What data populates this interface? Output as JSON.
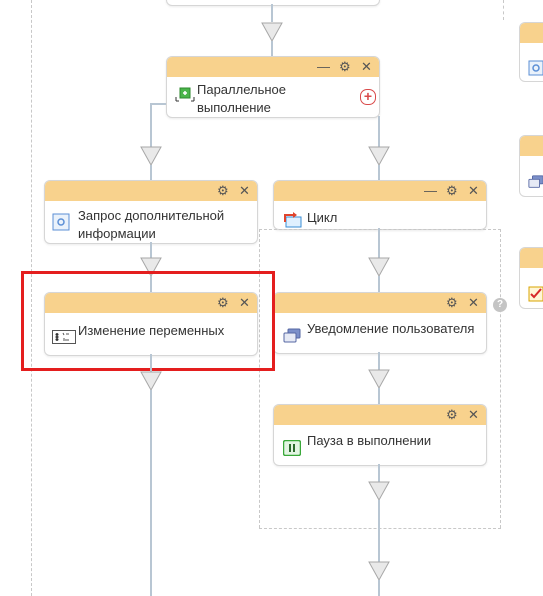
{
  "workflow": {
    "parallel": {
      "title": "Параллельное выполнение",
      "add_label": "+"
    },
    "request_info": {
      "title": "Запрос дополнительной информации"
    },
    "change_vars": {
      "title": "Изменение переменных"
    },
    "loop": {
      "title": "Цикл"
    },
    "notify": {
      "title": "Уведомление пользователя"
    },
    "pause": {
      "title": "Пауза в выполнении"
    },
    "help_label": "?"
  },
  "controls": {
    "minimize": "—",
    "settings": "⚙",
    "close": "✕"
  },
  "colors": {
    "card_header": "#f8d28d",
    "highlight": "#e41e1e",
    "connector": "#b8c6d3",
    "accent_blue": "#5b8fd6"
  }
}
